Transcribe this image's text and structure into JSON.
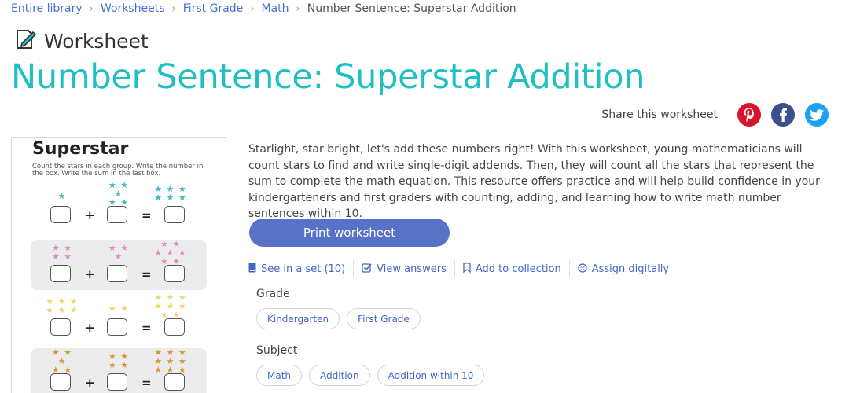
{
  "breadcrumb": {
    "items": [
      "Entire library",
      "Worksheets",
      "First Grade",
      "Math"
    ],
    "current": "Number Sentence: Superstar Addition"
  },
  "kind": {
    "icon": "worksheet-icon",
    "label": "Worksheet"
  },
  "title": "Number Sentence: Superstar Addition",
  "share": {
    "label": "Share this worksheet",
    "networks": [
      {
        "name": "pinterest-icon",
        "glyph": "P",
        "color": "#d7142b"
      },
      {
        "name": "facebook-icon",
        "glyph": "f",
        "color": "#3b4f8c"
      },
      {
        "name": "twitter-icon",
        "glyph": "t",
        "color": "#1da1f2"
      }
    ]
  },
  "preview": {
    "title": "Superstar",
    "instructions": "Count the stars in each group. Write the number in the box.  Write the sum in the last box.",
    "plus": "+",
    "equals": "=",
    "rows": [
      {
        "color": "#3fb6bf",
        "a": "★",
        "b": "★ ★\n★\n★ ★",
        "sum": "★ ★ ★\n★ ★ ★"
      },
      {
        "color": "#e08ac8",
        "a": "★ ★\n★ ★",
        "b": "★ ★\n★",
        "sum": "★ ★\n★ ★ ★\n★ ★"
      },
      {
        "color": "#efd46a",
        "a": "★ ★ ★\n★ ★ ★",
        "b": "★ ★",
        "sum": "★ ★ ★\n★ ★ ★\n★ ★"
      },
      {
        "color": "#d99535",
        "a": "★ ★\n★\n★ ★",
        "b": "★ ★\n★ ★",
        "sum": "★ ★ ★\n★ ★ ★\n★ ★ ★"
      }
    ]
  },
  "description": "Starlight, star bright, let's add these numbers right! With this worksheet, young mathematicians will count stars to find and write single-digit addends. Then, they will count all the stars that represent the sum to complete the math equation. This resource offers practice and will help build confidence in your kindergarteners and first graders with counting, adding, and learning how to write math number sentences within 10.",
  "print_button": "Print worksheet",
  "actions": [
    {
      "name": "see-in-set",
      "icon": "book-icon",
      "glyph": "▮",
      "label": "See in a set (10)"
    },
    {
      "name": "view-answers",
      "icon": "check-square-icon",
      "glyph": "☑",
      "label": "View answers"
    },
    {
      "name": "add-to-collection",
      "icon": "bookmark-icon",
      "glyph": "⌑",
      "label": "Add to collection"
    },
    {
      "name": "assign-digitally",
      "icon": "assign-icon",
      "glyph": "☺",
      "label": "Assign digitally"
    }
  ],
  "grade": {
    "label": "Grade",
    "tags": [
      "Kindergarten",
      "First Grade"
    ]
  },
  "subject": {
    "label": "Subject",
    "tags": [
      "Math",
      "Addition",
      "Addition within 10"
    ]
  },
  "colors": {
    "accent": "#1ec0c3",
    "button": "#5872c7",
    "link": "#4b6fd6"
  }
}
